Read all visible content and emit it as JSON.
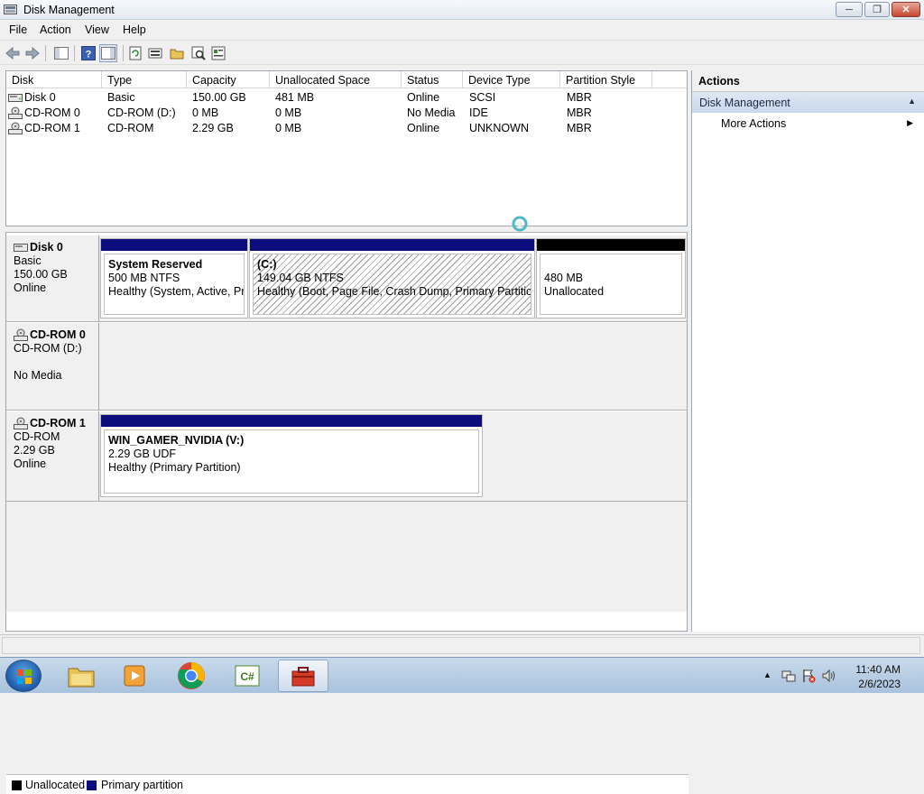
{
  "window": {
    "title": "Disk Management",
    "minimize": "─",
    "maximize": "❐",
    "close": "✕"
  },
  "menu": [
    "File",
    "Action",
    "View",
    "Help"
  ],
  "volume_list": {
    "columns": [
      "Disk",
      "Type",
      "Capacity",
      "Unallocated Space",
      "Status",
      "Device Type",
      "Partition Style"
    ],
    "rows": [
      {
        "icon": "hard-disk-icon",
        "cells": [
          "Disk 0",
          "Basic",
          "150.00 GB",
          "481 MB",
          "Online",
          "SCSI",
          "MBR"
        ]
      },
      {
        "icon": "cdrom-icon",
        "cells": [
          "CD-ROM 0",
          "CD-ROM (D:)",
          "0 MB",
          "0 MB",
          "No Media",
          "IDE",
          "MBR"
        ]
      },
      {
        "icon": "cdrom-icon",
        "cells": [
          "CD-ROM 1",
          "CD-ROM",
          "2.29 GB",
          "0 MB",
          "Online",
          "UNKNOWN",
          "MBR"
        ]
      }
    ]
  },
  "disks": [
    {
      "name": "Disk 0",
      "lines": [
        "Basic",
        "150.00 GB",
        "Online"
      ],
      "partitions": [
        {
          "name": "System Reserved",
          "size": "500 MB NTFS",
          "status": "Healthy (System, Active, Prir"
        },
        {
          "name": "(C:)",
          "size": "149.04 GB NTFS",
          "status": "Healthy (Boot, Page File, Crash Dump, Primary Partition)"
        },
        {
          "name": "",
          "size": "480 MB",
          "status": "Unallocated"
        }
      ]
    },
    {
      "name": "CD-ROM 0",
      "lines": [
        "CD-ROM (D:)",
        "",
        "No Media"
      ],
      "partitions": []
    },
    {
      "name": "CD-ROM 1",
      "lines": [
        "CD-ROM",
        "2.29 GB",
        "Online"
      ],
      "partitions": [
        {
          "name": "WIN_GAMER_NVIDIA  (V:)",
          "size": "2.29 GB UDF",
          "status": "Healthy (Primary Partition)"
        }
      ]
    }
  ],
  "legend": [
    {
      "label": "Unallocated",
      "color": "#000000"
    },
    {
      "label": "Primary partition",
      "color": "#0c0c7c"
    }
  ],
  "actions": {
    "header": "Actions",
    "section": "Disk Management",
    "more": "More Actions",
    "more_arrow": "▶",
    "section_arrow": "▲"
  },
  "taskbar": {
    "apps": [
      "explorer-icon",
      "media-player-icon",
      "chrome-icon",
      "csharp-icon",
      "toolbox-icon"
    ],
    "clock_time": "11:40 AM",
    "clock_date": "2/6/2023",
    "tray_arrow": "▲"
  }
}
